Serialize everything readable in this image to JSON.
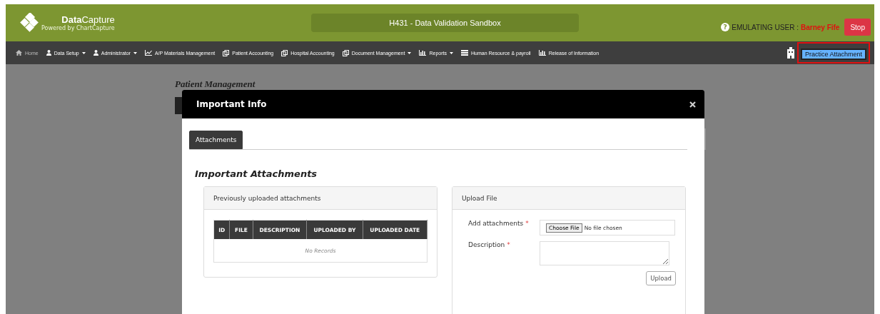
{
  "header": {
    "logo": "**Data**Capture",
    "tagline": "Powered by ChartCapture",
    "environment": "H431 - Data Validation Sandbox",
    "help_glyph": "?",
    "emulating_label": "EMULATING USER :",
    "emulating_user": "Barney Fife",
    "stop_button": "Stop"
  },
  "nav": [
    {
      "label": "Home",
      "dropdown": false,
      "muted": true
    },
    {
      "label": "Data Setup",
      "dropdown": true,
      "muted": false
    },
    {
      "label": "Administrator",
      "dropdown": true,
      "muted": false
    },
    {
      "label": "A/P Materials Management",
      "dropdown": false,
      "muted": false
    },
    {
      "label": "Patient Accounting",
      "dropdown": false,
      "muted": false
    },
    {
      "label": "Hospital Accounting",
      "dropdown": false,
      "muted": false
    },
    {
      "label": "Document Management",
      "dropdown": true,
      "muted": false
    },
    {
      "label": "Reports",
      "dropdown": true,
      "muted": false
    },
    {
      "label": "Human Resource & payroll",
      "dropdown": false,
      "muted": false
    },
    {
      "label": "Release of Information",
      "dropdown": false,
      "muted": false
    }
  ],
  "practice_button": {
    "label": "Practice Attachment",
    "highlighted": true
  },
  "background_page": {
    "title": "Patient Management"
  },
  "modal": {
    "title": "Important Info",
    "tabs": [
      {
        "label": "Attachments",
        "selected": true
      }
    ],
    "heading": "Important Attachments",
    "previous_panel": {
      "title": "Previously uploaded attachments",
      "columns": [
        "ID",
        "FILE",
        "DESCRIPTION",
        "UPLOADED BY",
        "UPLOADED DATE"
      ],
      "empty_text": "No Records"
    },
    "upload_panel": {
      "title": "Upload File",
      "fields": [
        {
          "kind": "file",
          "label": "Add attachments",
          "required_mark": "*",
          "button": "Choose File",
          "status": "No file chosen"
        },
        {
          "kind": "textarea",
          "label": "Description",
          "required_mark": "*"
        }
      ],
      "upload_button": "Upload"
    }
  }
}
